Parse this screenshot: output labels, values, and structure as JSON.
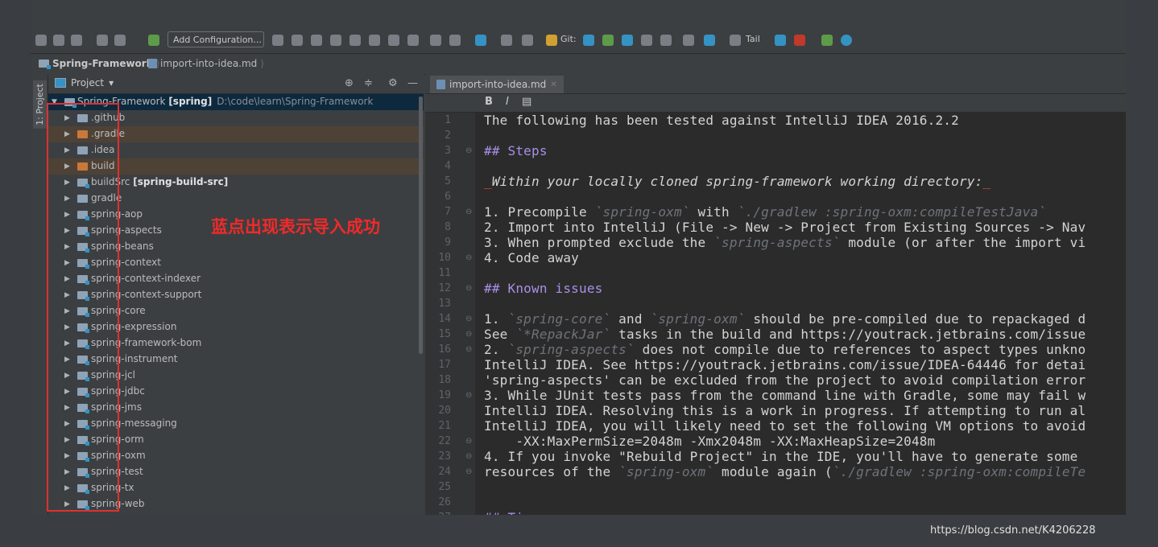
{
  "toolbar": {
    "add_configuration": "Add Configuration...",
    "git_label": "Git:",
    "tail_label": "Tail"
  },
  "breadcrumb": {
    "project": "Spring-Framework",
    "file": "import-into-idea.md"
  },
  "side_strip": {
    "label": "1: Project"
  },
  "project_panel": {
    "title": "Project",
    "dropdown": "▾"
  },
  "tree": {
    "root": {
      "name": "Spring-Framework",
      "module": "[spring]",
      "path": "D:\\code\\learn\\Spring-Framework"
    },
    "items": [
      {
        "label": ".github",
        "kind": "folder"
      },
      {
        "label": ".gradle",
        "kind": "excluded"
      },
      {
        "label": ".idea",
        "kind": "folder"
      },
      {
        "label": "build",
        "kind": "excluded"
      },
      {
        "label": "buildSrc",
        "module": "[spring-build-src]",
        "kind": "module"
      },
      {
        "label": "gradle",
        "kind": "folder"
      },
      {
        "label": "spring-aop",
        "kind": "module"
      },
      {
        "label": "spring-aspects",
        "kind": "module"
      },
      {
        "label": "spring-beans",
        "kind": "module"
      },
      {
        "label": "spring-context",
        "kind": "module"
      },
      {
        "label": "spring-context-indexer",
        "kind": "module"
      },
      {
        "label": "spring-context-support",
        "kind": "module"
      },
      {
        "label": "spring-core",
        "kind": "module"
      },
      {
        "label": "spring-expression",
        "kind": "module"
      },
      {
        "label": "spring-framework-bom",
        "kind": "module"
      },
      {
        "label": "spring-instrument",
        "kind": "module"
      },
      {
        "label": "spring-jcl",
        "kind": "module"
      },
      {
        "label": "spring-jdbc",
        "kind": "module"
      },
      {
        "label": "spring-jms",
        "kind": "module"
      },
      {
        "label": "spring-messaging",
        "kind": "module"
      },
      {
        "label": "spring-orm",
        "kind": "module"
      },
      {
        "label": "spring-oxm",
        "kind": "module"
      },
      {
        "label": "spring-test",
        "kind": "module"
      },
      {
        "label": "spring-tx",
        "kind": "module"
      },
      {
        "label": "spring-web",
        "kind": "module"
      }
    ]
  },
  "annotation": "蓝点出现表示导入成功",
  "editor": {
    "tab": "import-into-idea.md",
    "md_toolbar": {
      "bold": "B",
      "italic": "I",
      "code": "▤"
    },
    "line_numbers": [
      "1",
      "2",
      "3",
      "4",
      "5",
      "6",
      "7",
      "8",
      "9",
      "10",
      "11",
      "12",
      "13",
      "14",
      "15",
      "16",
      "17",
      "18",
      "19",
      "20",
      "21",
      "22",
      "23",
      "24",
      "25",
      "26",
      "27"
    ],
    "lines": [
      [
        {
          "t": "The following has been tested against IntelliJ IDEA 2016.2.2",
          "c": ""
        }
      ],
      [],
      [
        {
          "t": "## Steps",
          "c": "h"
        }
      ],
      [],
      [
        {
          "t": "_",
          "c": "ul"
        },
        {
          "t": "Within your locally cloned spring-framework working directory:",
          "c": "it"
        },
        {
          "t": "_",
          "c": "ul"
        }
      ],
      [],
      [
        {
          "t": "1. Precompile ",
          "c": ""
        },
        {
          "t": "`spring-oxm`",
          "c": "cd"
        },
        {
          "t": " with ",
          "c": ""
        },
        {
          "t": "`./gradlew :spring-oxm:compileTestJava`",
          "c": "cd"
        }
      ],
      [
        {
          "t": "2. Import into IntelliJ (File -> New -> Project from Existing Sources -> Nav",
          "c": ""
        }
      ],
      [
        {
          "t": "3. When prompted exclude the ",
          "c": ""
        },
        {
          "t": "`spring-aspects`",
          "c": "cd"
        },
        {
          "t": " module (or after the import vi",
          "c": ""
        }
      ],
      [
        {
          "t": "4. Code away",
          "c": ""
        }
      ],
      [],
      [
        {
          "t": "## Known issues",
          "c": "h"
        }
      ],
      [],
      [
        {
          "t": "1. ",
          "c": ""
        },
        {
          "t": "`spring-core`",
          "c": "cd"
        },
        {
          "t": " and ",
          "c": ""
        },
        {
          "t": "`spring-oxm`",
          "c": "cd"
        },
        {
          "t": " should be pre-compiled due to repackaged d",
          "c": ""
        }
      ],
      [
        {
          "t": "See ",
          "c": ""
        },
        {
          "t": "`*RepackJar`",
          "c": "cd"
        },
        {
          "t": " tasks in the build and https://youtrack.jetbrains.com/issue",
          "c": ""
        }
      ],
      [
        {
          "t": "2. ",
          "c": ""
        },
        {
          "t": "`spring-aspects`",
          "c": "cd"
        },
        {
          "t": " does not compile due to references to aspect types unkno",
          "c": ""
        }
      ],
      [
        {
          "t": "IntelliJ IDEA. See https://youtrack.jetbrains.com/issue/IDEA-64446 for detai",
          "c": ""
        }
      ],
      [
        {
          "t": "'spring-aspects' can be excluded from the project to avoid compilation error",
          "c": ""
        }
      ],
      [
        {
          "t": "3. While JUnit tests pass from the command line with Gradle, some may fail w",
          "c": ""
        }
      ],
      [
        {
          "t": "IntelliJ IDEA. Resolving this is a work in progress. If attempting to run al",
          "c": ""
        }
      ],
      [
        {
          "t": "IntelliJ IDEA, you will likely need to set the following VM options to avoid",
          "c": ""
        }
      ],
      [
        {
          "t": "    -XX:MaxPermSize=2048m -Xmx2048m -XX:MaxHeapSize=2048m",
          "c": ""
        }
      ],
      [
        {
          "t": "4. If you invoke \"Rebuild Project\" in the IDE, you'll have to generate some ",
          "c": ""
        }
      ],
      [
        {
          "t": "resources of the ",
          "c": ""
        },
        {
          "t": "`spring-oxm`",
          "c": "cd"
        },
        {
          "t": " module again (",
          "c": ""
        },
        {
          "t": "`./gradlew :spring-oxm:compileTe",
          "c": "cd"
        }
      ],
      [],
      [],
      [
        {
          "t": "## Ti",
          "c": "h"
        }
      ]
    ]
  },
  "watermark": "https://blog.csdn.net/K4206228",
  "colors": {
    "selection": "#0d293e",
    "excluded": "#4e4236",
    "annotation": "#f02a2a",
    "heading": "#a98fe8"
  }
}
